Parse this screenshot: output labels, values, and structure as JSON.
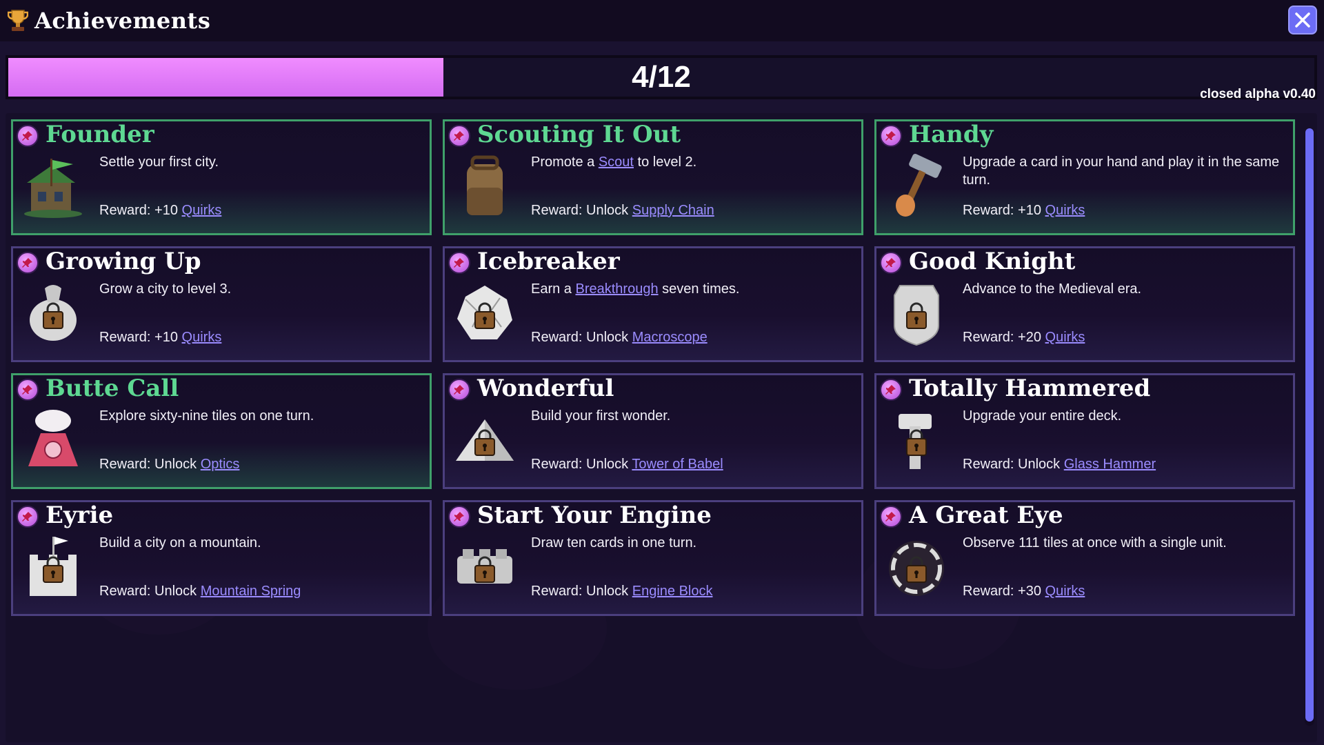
{
  "header": {
    "title": "Achievements",
    "trophy_icon": "trophy-icon",
    "close_icon": "close-icon"
  },
  "progress": {
    "text": "4/12",
    "fraction": 0.3333,
    "color": "#e57cfa"
  },
  "version": "closed alpha v0.40",
  "reward_prefix": "Reward:",
  "cards": [
    {
      "title": "Founder",
      "completed": true,
      "icon": "village-house-icon",
      "desc": [
        "Settle your first city."
      ],
      "reward": [
        "+10",
        "Quirks"
      ]
    },
    {
      "title": "Scouting It Out",
      "completed": true,
      "icon": "backpack-icon",
      "desc": [
        "Promote a",
        "Scout",
        "to level 2."
      ],
      "reward": [
        "Unlock",
        "Supply Chain"
      ]
    },
    {
      "title": "Handy",
      "completed": true,
      "icon": "hammer-icon",
      "desc": [
        "Upgrade a card in your hand and play it in the same turn."
      ],
      "reward": [
        "+10",
        "Quirks"
      ]
    },
    {
      "title": "Growing Up",
      "completed": false,
      "icon": "locked-sack-icon",
      "desc": [
        "Grow a city to level 3."
      ],
      "reward": [
        "+10",
        "Quirks"
      ]
    },
    {
      "title": "Icebreaker",
      "completed": false,
      "icon": "locked-ice-icon",
      "desc": [
        "Earn a",
        "Breakthrough",
        "seven times."
      ],
      "reward": [
        "Unlock",
        "Macroscope"
      ]
    },
    {
      "title": "Good Knight",
      "completed": false,
      "icon": "locked-shield-icon",
      "desc": [
        "Advance to the Medieval era."
      ],
      "reward": [
        "+20",
        "Quirks"
      ]
    },
    {
      "title": "Butte Call",
      "completed": true,
      "icon": "telephone-icon",
      "desc": [
        "Explore sixty-nine tiles on one turn."
      ],
      "reward": [
        "Unlock",
        "Optics"
      ]
    },
    {
      "title": "Wonderful",
      "completed": false,
      "icon": "locked-pyramid-icon",
      "desc": [
        "Build your first wonder."
      ],
      "reward": [
        "Unlock",
        "Tower of Babel"
      ]
    },
    {
      "title": "Totally Hammered",
      "completed": false,
      "icon": "locked-hammer-icon",
      "desc": [
        "Upgrade your entire deck."
      ],
      "reward": [
        "Unlock",
        "Glass Hammer"
      ]
    },
    {
      "title": "Eyrie",
      "completed": false,
      "icon": "locked-castle-icon",
      "desc": [
        "Build a city on a mountain."
      ],
      "reward": [
        "Unlock",
        "Mountain Spring"
      ]
    },
    {
      "title": "Start Your Engine",
      "completed": false,
      "icon": "locked-engine-icon",
      "desc": [
        "Draw ten cards in one turn."
      ],
      "reward": [
        "Unlock",
        "Engine Block"
      ]
    },
    {
      "title": "A Great Eye",
      "completed": false,
      "icon": "locked-eye-icon",
      "desc": [
        "Observe 111 tiles at once with a single unit."
      ],
      "reward": [
        "+30",
        "Quirks"
      ]
    }
  ]
}
